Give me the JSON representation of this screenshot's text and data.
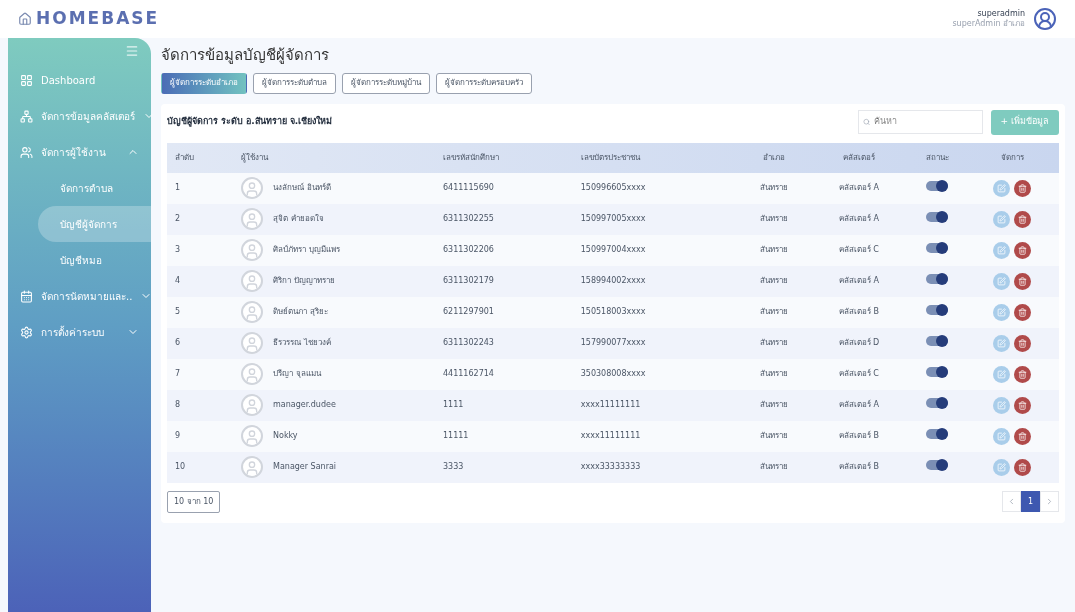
{
  "logo": "HOMEBASE",
  "user": {
    "name": "superadmin",
    "role": "superAdmin อำเภอ"
  },
  "sidebar": {
    "items": [
      {
        "label": "Dashboard",
        "kind": "dashboard"
      },
      {
        "label": "จัดการข้อมูลคลัสเตอร์",
        "kind": "cluster",
        "expanded": false
      },
      {
        "label": "จัดการผู้ใช้งาน",
        "kind": "users",
        "expanded": true,
        "children": [
          {
            "label": "จัดการตำบล",
            "selected": false
          },
          {
            "label": "บัญชีผู้จัดการ",
            "selected": true
          },
          {
            "label": "บัญชีหมอ",
            "selected": false
          }
        ]
      },
      {
        "label": "จัดการนัดหมายและ..",
        "kind": "calendar",
        "expanded": false
      },
      {
        "label": "การตั้งค่าระบบ",
        "kind": "settings",
        "expanded": false
      }
    ]
  },
  "page_title": "จัดการข้อมูลบัญชีผู้จัดการ",
  "tabs": [
    {
      "label": "ผู้จัดการระดับอำเภอ",
      "selected": true
    },
    {
      "label": "ผู้จัดการระดับตำบล",
      "selected": false
    },
    {
      "label": "ผู้จัดการระดับหมู่บ้าน",
      "selected": false
    },
    {
      "label": "ผู้จัดการระดับครอบครัว",
      "selected": false
    }
  ],
  "table_title": "บัญชีผู้จัดการ ระดับ อ.สันทราย จ.เชียงใหม่",
  "search": {
    "placeholder": "ค้นหา"
  },
  "add_button": "+ เพิ่มข้อมูล",
  "table": {
    "columns": [
      "ลำดับ",
      "ผู้ใช้งาน",
      "เลขรหัสนักศึกษา",
      "เลขบัตรประชาชน",
      "อำเภอ",
      "คลัสเตอร์",
      "สถานะ",
      "จัดการ"
    ],
    "rows": [
      {
        "no": "1",
        "name": "นงลักษณ์ อินทร์ดี",
        "id": "6411115690",
        "citizen": "150996605xxxx",
        "district": "สันทราย",
        "cluster": "คลัสเตอร์ A",
        "on": true
      },
      {
        "no": "2",
        "name": "สุจิต คำยอดใจ",
        "id": "6311302255",
        "citizen": "150997005xxxx",
        "district": "สันทราย",
        "cluster": "คลัสเตอร์ A",
        "on": true
      },
      {
        "no": "3",
        "name": "ศิลป์ภัทรา บุญมีแพร",
        "id": "6311302206",
        "citizen": "150997004xxxx",
        "district": "สันทราย",
        "cluster": "คลัสเตอร์ C",
        "on": true
      },
      {
        "no": "4",
        "name": "ศิริกา ปัญญาทราย",
        "id": "6311302179",
        "citizen": "158994002xxxx",
        "district": "สันทราย",
        "cluster": "คลัสเตอร์ A",
        "on": true
      },
      {
        "no": "5",
        "name": "ดิษย์ตนภา สุริยะ",
        "id": "6211297901",
        "citizen": "150518003xxxx",
        "district": "สันทราย",
        "cluster": "คลัสเตอร์ B",
        "on": true
      },
      {
        "no": "6",
        "name": "ธีรวรรณ ไชยวงค์",
        "id": "6311302243",
        "citizen": "157990077xxxx",
        "district": "สันทราย",
        "cluster": "คลัสเตอร์ D",
        "on": true
      },
      {
        "no": "7",
        "name": "ปรีญา จุลแมน",
        "id": "4411162714",
        "citizen": "350308008xxxx",
        "district": "สันทราย",
        "cluster": "คลัสเตอร์ C",
        "on": true
      },
      {
        "no": "8",
        "name": "manager.dudee",
        "id": "1111",
        "citizen": "xxxx11111111",
        "district": "สันทราย",
        "cluster": "คลัสเตอร์ A",
        "on": true
      },
      {
        "no": "9",
        "name": "Nokky",
        "id": "11111",
        "citizen": "xxxx11111111",
        "district": "สันทราย",
        "cluster": "คลัสเตอร์ B",
        "on": true
      },
      {
        "no": "10",
        "name": "Manager Sanrai",
        "id": "3333",
        "citizen": "xxxx33333333",
        "district": "สันทราย",
        "cluster": "คลัสเตอร์ B",
        "on": true
      }
    ]
  },
  "footer": {
    "count": "10 จาก 10",
    "pages": [
      {
        "label": "1",
        "selected": true
      }
    ]
  }
}
